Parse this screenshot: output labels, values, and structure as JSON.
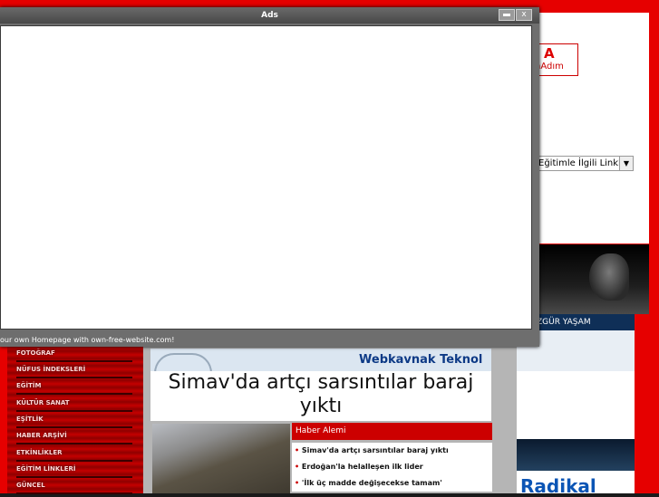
{
  "popup": {
    "title": "Ads",
    "footer": "our own Homepage with own-free-website.com!",
    "minimize_icon": "minimize-icon",
    "close_label": "x"
  },
  "header": {
    "logo_mark": "A",
    "logo_text": "nAdım"
  },
  "links_select": {
    "value": "Eğitimle İlgili Linkler",
    "arrow": "▼"
  },
  "right_column": {
    "yasam_label": "ZGÜR YAŞAM",
    "radikal_text": "Radikal"
  },
  "sidebar": {
    "items": [
      {
        "label": "FOTOĞRAF"
      },
      {
        "label": "NÜFUS İNDEKSLERİ"
      },
      {
        "label": "EĞİTİM"
      },
      {
        "label": "KÜLTÜR SANAT"
      },
      {
        "label": "EŞİTLİK"
      },
      {
        "label": "HABER ARŞİVİ"
      },
      {
        "label": "ETKİNLİKLER"
      },
      {
        "label": "EĞİTİM LİNKLERİ"
      },
      {
        "label": "GÜNCEL"
      }
    ]
  },
  "main": {
    "banner_text": "Webkavnak Teknol",
    "headline": "Simav'da artçı sarsıntılar baraj yıktı",
    "news_header": "Haber Alemi",
    "news_items": [
      "Simav'da artçı sarsıntılar baraj yıktı",
      "Erdoğan'la helalleşen ilk lider",
      "'İlk üç madde değişecekse tamam'"
    ]
  },
  "colors": {
    "frame_red": "#e60000",
    "news_red": "#cc0000",
    "navy": "#0f2f57"
  }
}
